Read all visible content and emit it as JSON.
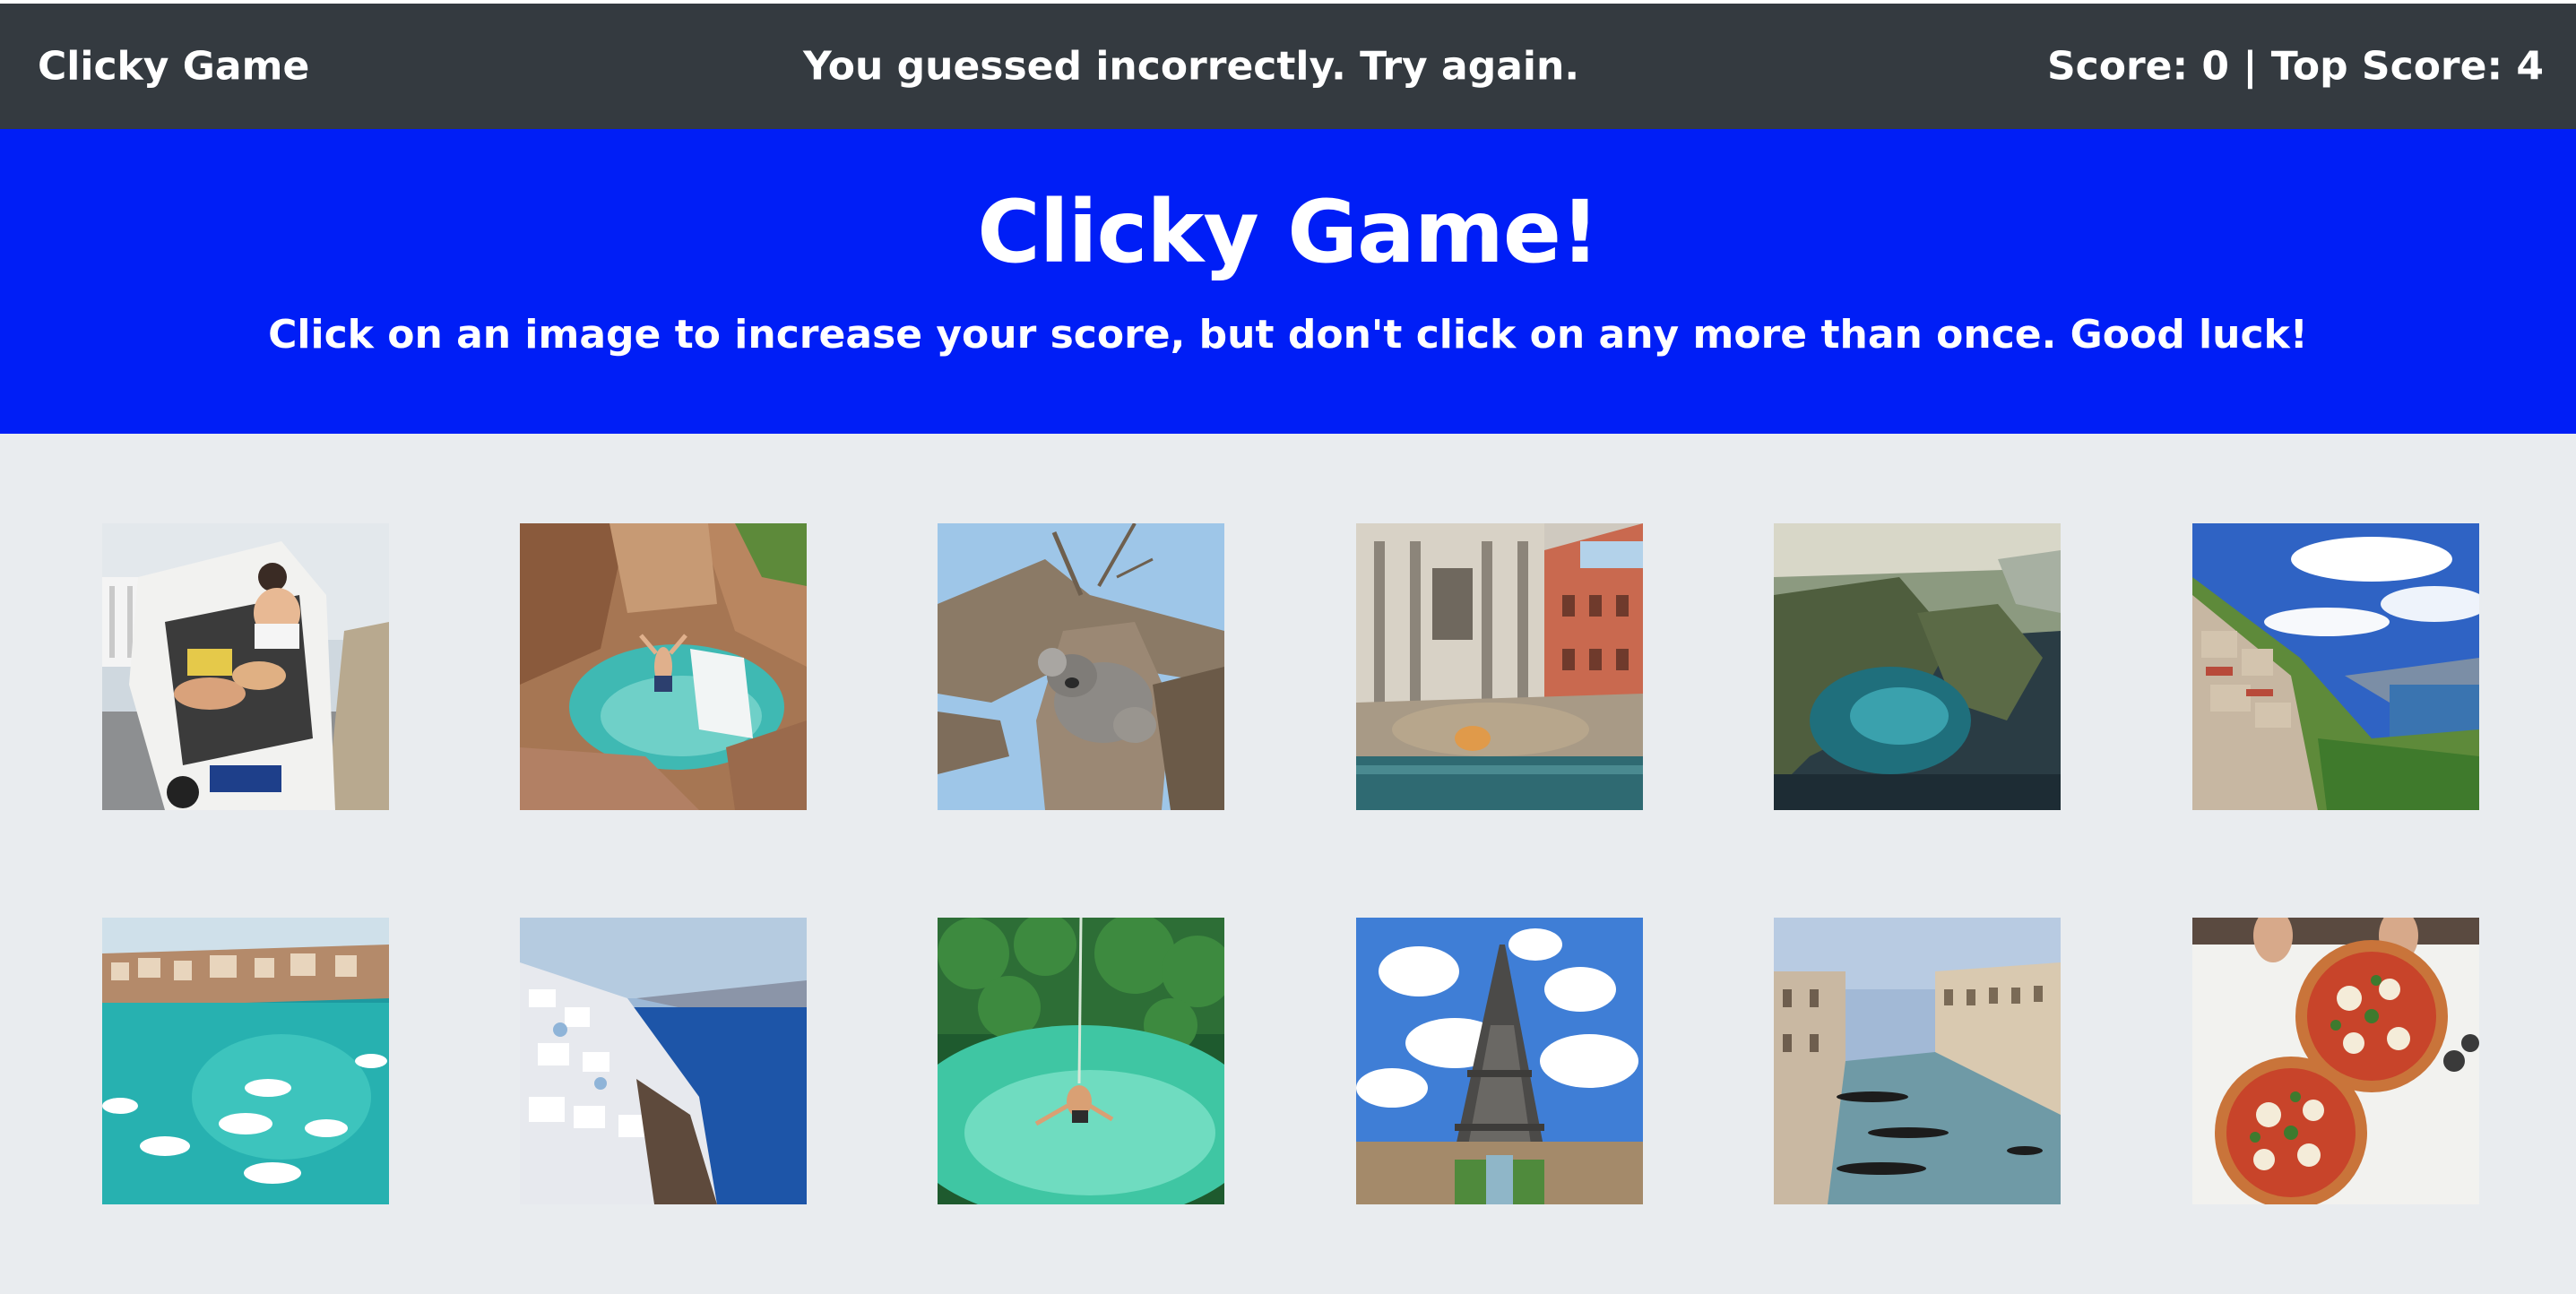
{
  "navbar": {
    "brand": "Clicky Game",
    "message": "You guessed incorrectly. Try again.",
    "score_text": "Score: 0 | Top Score: 4"
  },
  "hero": {
    "title": "Clicky Game!",
    "subtitle": "Click on an image to increase your score, but don't click on any more than once. Good luck!"
  },
  "colors": {
    "navbar_bg": "#343a40",
    "hero_bg": "#001ef6",
    "page_bg": "#e9ecef",
    "text": "#ffffff"
  },
  "images": [
    {
      "name": "van-travelers-photo"
    },
    {
      "name": "canyon-waterfall-jump-photo"
    },
    {
      "name": "koala-in-tree-photo"
    },
    {
      "name": "trevi-fountain-photo"
    },
    {
      "name": "aerial-coast-cliffs-photo"
    },
    {
      "name": "cliffside-coastal-town-photo"
    },
    {
      "name": "harbor-boats-photo"
    },
    {
      "name": "santorini-cliffs-photo"
    },
    {
      "name": "jungle-lagoon-swing-photo"
    },
    {
      "name": "eiffel-tower-photo"
    },
    {
      "name": "venice-grand-canal-photo"
    },
    {
      "name": "pizzas-on-table-photo"
    }
  ]
}
